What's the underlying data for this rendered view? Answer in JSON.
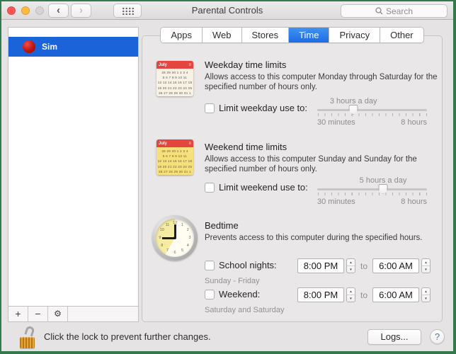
{
  "window": {
    "title": "Parental Controls",
    "search_placeholder": "Search"
  },
  "titlebar": {
    "back_glyph": "‹",
    "forward_glyph": "›"
  },
  "tabs": [
    {
      "label": "Apps",
      "selected": false
    },
    {
      "label": "Web",
      "selected": false
    },
    {
      "label": "Stores",
      "selected": false
    },
    {
      "label": "Time",
      "selected": true
    },
    {
      "label": "Privacy",
      "selected": false
    },
    {
      "label": "Other",
      "selected": false
    }
  ],
  "sidebar": {
    "users": [
      {
        "name": "Sim"
      }
    ],
    "toolbar": {
      "add_label": "+",
      "remove_label": "−",
      "action_glyph": "⚙"
    }
  },
  "sections": {
    "weekday": {
      "title": "Weekday time limits",
      "description": "Allows access to this computer Monday through Saturday for the specified number of hours only.",
      "checkbox_label": "Limit weekday use to:",
      "slider": {
        "value_label": "3 hours a day",
        "min_label": "30 minutes",
        "max_label": "8 hours",
        "position_pct": 33
      }
    },
    "weekend": {
      "title": "Weekend time limits",
      "description": "Allows access to this computer Sunday and Sunday for the specified number of hours only.",
      "checkbox_label": "Limit weekend use to:",
      "slider": {
        "value_label": "5 hours a day",
        "min_label": "30 minutes",
        "max_label": "8 hours",
        "position_pct": 60
      }
    },
    "bedtime": {
      "title": "Bedtime",
      "description": "Prevents access to this computer during the specified hours.",
      "school_nights": {
        "checkbox_label": "School nights:",
        "sub_label": "Sunday - Friday",
        "from": "8:00 PM",
        "to_word": "to",
        "to": "6:00 AM"
      },
      "weekend": {
        "checkbox_label": "Weekend:",
        "sub_label": "Saturday and Saturday",
        "from": "8:00 PM",
        "to_word": "to",
        "to": "6:00 AM"
      }
    }
  },
  "controls": {
    "stepper_up": "▲",
    "stepper_down": "▼"
  },
  "footer": {
    "lock_text": "Click the lock to prevent further changes.",
    "logs_label": "Logs...",
    "help_label": "?"
  },
  "icons": {
    "calendar": {
      "month": "July",
      "menu_glyph": "≡",
      "rows": [
        "28 29 30 1 2 3 4",
        "5 6 7 8 9 10 11",
        "12 13 14 15 16 17 18",
        "19 20 21 22 23 24 25",
        "26 27 28 29 30 31 1"
      ]
    },
    "clock": {
      "numbers": [
        "12",
        "1",
        "2",
        "3",
        "4",
        "5",
        "6",
        "7",
        "8",
        "9",
        "10",
        "11"
      ]
    }
  },
  "colors": {
    "frame_green": "#35784e",
    "selection_blue": "#1b63d8",
    "tab_blue": "#1d6be4",
    "calendar_red": "#e4453e",
    "lock_orange": "#d9922c"
  }
}
